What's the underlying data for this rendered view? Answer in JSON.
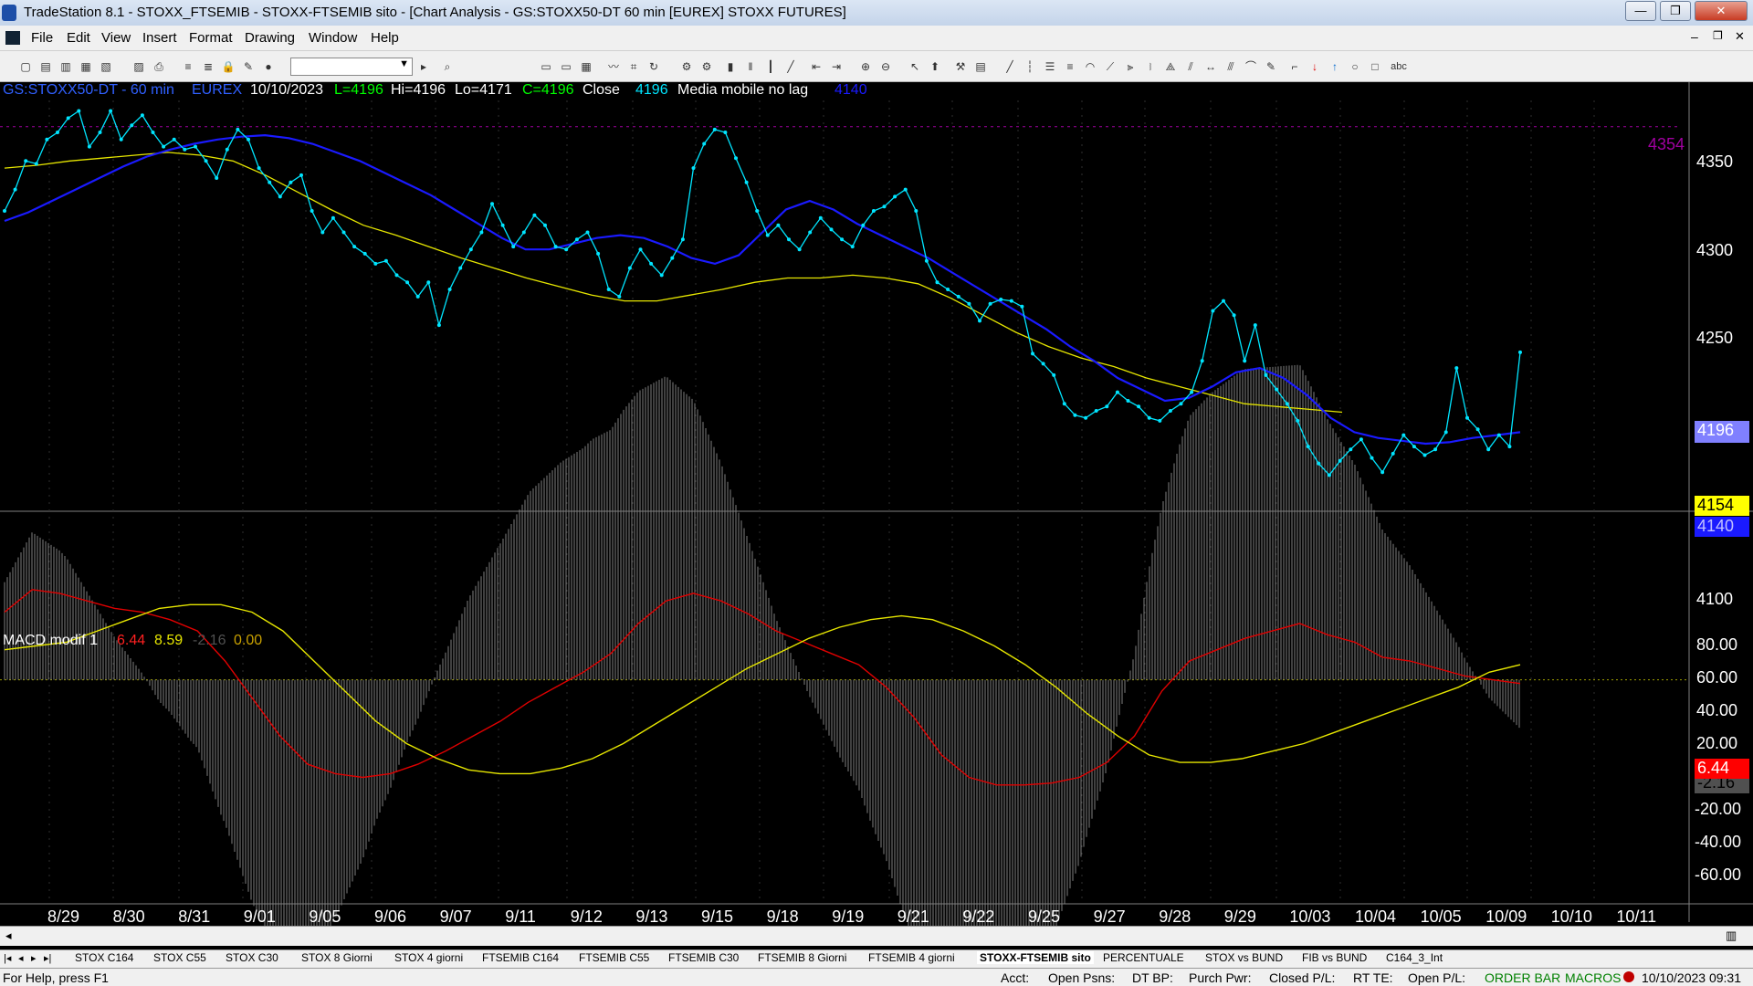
{
  "window": {
    "title": "TradeStation 8.1 - STOXX_FTSEMIB - STOXX-FTSEMIB sito - [Chart Analysis - GS:STOXX50-DT  60 min  [EUREX] STOXX FUTURES]"
  },
  "menu": [
    "File",
    "Edit",
    "View",
    "Insert",
    "Format",
    "Drawing",
    "Window",
    "Help"
  ],
  "header": {
    "symbol": "GS:STOXX50-DT - 60 min",
    "exchange": "EUREX",
    "date": "10/10/2023",
    "last": "L=4196",
    "high": "Hi=4196",
    "low": "Lo=4171",
    "close": "C=4196",
    "close_label": "Close",
    "close_value": "4196",
    "ma_label": "Media mobile no lag",
    "ma_value": "4140"
  },
  "macd": {
    "label": "MACD modif 1",
    "v1": "6.44",
    "v2": "8.59",
    "v3": "-2.16",
    "v4": "0.00"
  },
  "price_axis": {
    "ticks": [
      "4350",
      "4300",
      "4250",
      "4100"
    ],
    "hline_label": "4354",
    "tag_close": "4196",
    "tag_yellow": "4154",
    "tag_blue": "4140"
  },
  "macd_axis": {
    "ticks": [
      "80.00",
      "60.00",
      "40.00",
      "20.00",
      "-20.00",
      "-40.00",
      "-60.00"
    ],
    "tag_red": "6.44",
    "tag_gray": "-2.16"
  },
  "date_labels": [
    "8/29",
    "8/30",
    "8/31",
    "9/01",
    "9/05",
    "9/06",
    "9/07",
    "9/11",
    "9/12",
    "9/13",
    "9/15",
    "9/18",
    "9/19",
    "9/21",
    "9/22",
    "9/25",
    "9/27",
    "9/28",
    "9/29",
    "10/03",
    "10/04",
    "10/05",
    "10/09",
    "10/10",
    "10/11"
  ],
  "tabs": [
    "STOX C164",
    "STOX C55",
    "STOX  C30",
    "STOX  8 Giorni",
    "STOX 4 giorni",
    "FTSEMIB C164",
    "FTSEMIB C55",
    "FTSEMIB C30",
    "FTSEMIB  8 Giorni",
    "FTSEMIB  4 giorni",
    "STOXX-FTSEMIB sito",
    "PERCENTUALE",
    "STOX vs BUND",
    "FIB vs BUND",
    "C164_3_Int"
  ],
  "status": {
    "help": "For Help, press F1",
    "acct": "Acct:",
    "open_psns": "Open Psns:",
    "dt_bp": "DT BP:",
    "purch_pwr": "Purch Pwr:",
    "closed_pl": "Closed P/L:",
    "rt_te": "RT TE:",
    "open_pl": "Open P/L:",
    "order_bar": "ORDER BAR",
    "macros": "MACROS",
    "datetime": "10/10/2023 09:31"
  },
  "colors": {
    "price": "#00e5ff",
    "ma_blue": "#1a1aff",
    "ma_yellow": "#e6e600",
    "macd_red": "#e00000",
    "macd_yellow": "#e6e600",
    "hist": "#808080",
    "hline": "#a000a0",
    "header_green": "#00ff00",
    "header_blue": "#3060ff"
  },
  "chart_data": {
    "type": "line",
    "price_range": [
      4085,
      4385
    ],
    "macd_range": [
      -70,
      82
    ],
    "price_close": [
      4295,
      4310,
      4330,
      4328,
      4345,
      4350,
      4360,
      4365,
      4340,
      4350,
      4365,
      4345,
      4355,
      4362,
      4350,
      4340,
      4345,
      4338,
      4340,
      4330,
      4318,
      4338,
      4352,
      4345,
      4325,
      4315,
      4305,
      4315,
      4320,
      4295,
      4280,
      4290,
      4280,
      4270,
      4265,
      4258,
      4260,
      4250,
      4245,
      4235,
      4245,
      4215,
      4240,
      4255,
      4268,
      4280,
      4300,
      4285,
      4270,
      4280,
      4292,
      4285,
      4270,
      4268,
      4275,
      4280,
      4265,
      4240,
      4235,
      4255,
      4268,
      4258,
      4250,
      4262,
      4275,
      4325,
      4342,
      4352,
      4350,
      4332,
      4315,
      4295,
      4278,
      4285,
      4275,
      4268,
      4280,
      4290,
      4282,
      4275,
      4270,
      4285,
      4295,
      4298,
      4305,
      4310,
      4295,
      4260,
      4245,
      4240,
      4235,
      4230,
      4218,
      4230,
      4233,
      4232,
      4228,
      4195,
      4188,
      4180,
      4160,
      4152,
      4150,
      4155,
      4158,
      4168,
      4162,
      4158,
      4150,
      4148,
      4155,
      4160,
      4168,
      4190,
      4225,
      4232,
      4222,
      4190,
      4215,
      4180,
      4170,
      4160,
      4148,
      4130,
      4118,
      4110,
      4120,
      4128,
      4135,
      4122,
      4112,
      4125,
      4138,
      4130,
      4124,
      4128,
      4140,
      4185,
      4150,
      4142,
      4128,
      4138,
      4130,
      4196
    ],
    "ma_blue": [
      4288,
      4294,
      4302,
      4310,
      4318,
      4326,
      4333,
      4338,
      4342,
      4345,
      4347,
      4348,
      4346,
      4342,
      4336,
      4330,
      4322,
      4314,
      4306,
      4296,
      4286,
      4276,
      4268,
      4268,
      4272,
      4276,
      4278,
      4276,
      4270,
      4262,
      4258,
      4264,
      4280,
      4296,
      4302,
      4296,
      4286,
      4278,
      4270,
      4262,
      4252,
      4242,
      4232,
      4222,
      4212,
      4200,
      4190,
      4178,
      4170,
      4162,
      4164,
      4172,
      4182,
      4185,
      4178,
      4166,
      4150,
      4140,
      4136,
      4134,
      4132,
      4133,
      4136,
      4138,
      4140
    ],
    "ma_yellow": [
      4325,
      4327,
      4330,
      4332,
      4334,
      4336,
      4334,
      4330,
      4320,
      4308,
      4296,
      4285,
      4278,
      4270,
      4262,
      4255,
      4248,
      4242,
      4236,
      4232,
      4232,
      4236,
      4240,
      4245,
      4248,
      4248,
      4250,
      4248,
      4244,
      4234,
      4222,
      4210,
      4200,
      4192,
      4186,
      4178,
      4172,
      4166,
      4160,
      4158,
      4156,
      4154
    ],
    "macd_red": [
      36,
      48,
      46,
      42,
      38,
      36,
      32,
      26,
      10,
      -10,
      -30,
      -45,
      -50,
      -52,
      -50,
      -45,
      -38,
      -30,
      -22,
      -12,
      -4,
      4,
      14,
      30,
      42,
      46,
      42,
      35,
      26,
      20,
      14,
      8,
      -4,
      -20,
      -40,
      -52,
      -56,
      -56,
      -55,
      -52,
      -44,
      -30,
      -6,
      10,
      16,
      22,
      26,
      30,
      24,
      20,
      12,
      10,
      6,
      2,
      0,
      -2
    ],
    "macd_yellow": [
      16,
      18,
      20,
      26,
      32,
      38,
      40,
      40,
      36,
      26,
      10,
      -6,
      -22,
      -34,
      -42,
      -48,
      -50,
      -50,
      -47,
      -42,
      -34,
      -24,
      -14,
      -4,
      6,
      14,
      22,
      28,
      32,
      34,
      32,
      26,
      18,
      8,
      -4,
      -18,
      -30,
      -40,
      -44,
      -44,
      -42,
      -38,
      -34,
      -28,
      -22,
      -16,
      -10,
      -4,
      4,
      8
    ]
  }
}
